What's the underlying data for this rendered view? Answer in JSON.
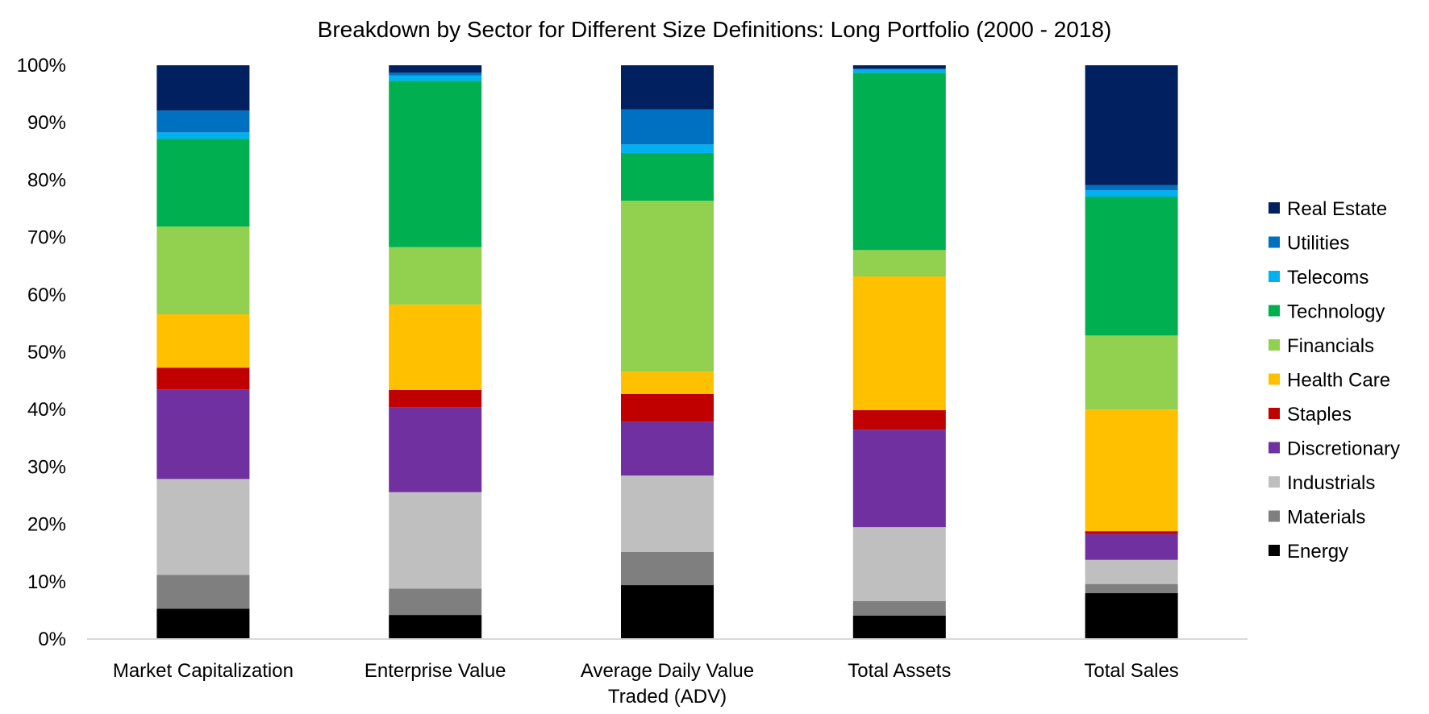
{
  "chart_data": {
    "type": "bar",
    "stacked": true,
    "normalized": true,
    "title": "Breakdown by Sector for Different Size Definitions: Long Portfolio (2000 - 2018)",
    "xlabel": "",
    "ylabel": "",
    "ylim": [
      0,
      100
    ],
    "yticks": [
      "0%",
      "10%",
      "20%",
      "30%",
      "40%",
      "50%",
      "60%",
      "70%",
      "80%",
      "90%",
      "100%"
    ],
    "grid": false,
    "legend_position": "right",
    "categories": [
      [
        "Market Capitalization"
      ],
      [
        "Enterprise Value"
      ],
      [
        "Average Daily Value",
        "Traded (ADV)"
      ],
      [
        "Total Assets"
      ],
      [
        "Total Sales"
      ]
    ],
    "series": [
      {
        "name": "Energy",
        "color": "#000000",
        "values": [
          5.3,
          4.2,
          9.4,
          4.1,
          8.0
        ]
      },
      {
        "name": "Materials",
        "color": "#7f7f7f",
        "values": [
          5.9,
          4.6,
          5.8,
          2.5,
          1.6
        ]
      },
      {
        "name": "Industrials",
        "color": "#bfbfbf",
        "values": [
          16.7,
          16.8,
          13.3,
          12.9,
          4.2
        ]
      },
      {
        "name": "Discretionary",
        "color": "#7030a0",
        "values": [
          15.6,
          14.8,
          9.4,
          17.0,
          4.5
        ]
      },
      {
        "name": "Staples",
        "color": "#c00000",
        "values": [
          3.8,
          3.0,
          4.8,
          3.4,
          0.5
        ]
      },
      {
        "name": "Health Care",
        "color": "#ffc000",
        "values": [
          9.3,
          14.9,
          3.9,
          23.3,
          21.2
        ]
      },
      {
        "name": "Financials",
        "color": "#92d050",
        "values": [
          15.3,
          10.0,
          29.8,
          4.6,
          12.9
        ]
      },
      {
        "name": "Technology",
        "color": "#00b050",
        "values": [
          15.3,
          29.0,
          8.3,
          30.9,
          24.2
        ]
      },
      {
        "name": "Telecoms",
        "color": "#00b0f0",
        "values": [
          1.1,
          0.9,
          1.5,
          0.6,
          1.1
        ]
      },
      {
        "name": "Utilities",
        "color": "#0070c0",
        "values": [
          3.8,
          0.5,
          6.1,
          0.1,
          0.9
        ]
      },
      {
        "name": "Real Estate",
        "color": "#002060",
        "values": [
          7.9,
          1.3,
          7.7,
          0.6,
          20.9
        ]
      }
    ],
    "legend_order": [
      "Real Estate",
      "Utilities",
      "Telecoms",
      "Technology",
      "Financials",
      "Health Care",
      "Staples",
      "Discretionary",
      "Industrials",
      "Materials",
      "Energy"
    ]
  }
}
